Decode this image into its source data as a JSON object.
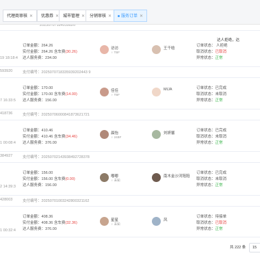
{
  "tabs": [
    {
      "label": "代理商审核",
      "active": false
    },
    {
      "label": "优惠券",
      "active": false
    },
    {
      "label": "城市管理",
      "active": false
    },
    {
      "label": "分销审核",
      "active": false
    },
    {
      "label": "服务订单",
      "active": true
    }
  ],
  "top_partial_order": "20250707184059826",
  "top_right_header": "达人拒绝，达",
  "orders": [
    {
      "time": "19 18:18:4",
      "total": "264.26",
      "paid": "264.26",
      "fare": "(30.26)",
      "service_fee": "234.00",
      "user_name": "访访",
      "user_tag": "TBF",
      "pro_name": "王千晗",
      "status_line1": "订单状态：",
      "status_line1_val": "人拒绝",
      "cancel_label": "取消状态：",
      "cancel_val": "已取消",
      "abnormal_label": "异常状态：",
      "abnormal_val": "正常"
    },
    {
      "time": "7 16:33:5",
      "total": "170.00",
      "paid": "170.00",
      "fare": "(14.00)",
      "service_fee": "156.00",
      "user_name": "佳佳",
      "user_tag": "TBF",
      "pro_name": "MIJA",
      "status_line1": "订单状态：",
      "status_line1_val": "已完成",
      "cancel_label": "取消状态：",
      "cancel_val": "未取消",
      "abnormal_label": "异常状态：",
      "abnormal_val": "正常"
    },
    {
      "time": "1 00:08:4",
      "total": "410.46",
      "paid": "410.46",
      "fare": "(34.46)",
      "service_fee": "376.00",
      "user_name": "晨怡",
      "user_tag": "24BF",
      "pro_name": "刘妍馨",
      "status_line1": "订单状态：",
      "status_line1_val": "已完成",
      "cancel_label": "取消状态：",
      "cancel_val": "未取消",
      "abnormal_label": "异常状态：",
      "abnormal_val": "正常"
    },
    {
      "time": "2 14:39:3",
      "total": "156.00",
      "paid": "156.00",
      "fare": "(0.00)",
      "service_fee": "156.00",
      "user_name": "嘟嘟",
      "user_tag": "未知",
      "pro_name": "南木金沙河陪陪",
      "status_line1": "订单状态：",
      "status_line1_val": "已完成",
      "cancel_label": "取消状态：",
      "cancel_val": "未取消",
      "abnormal_label": "异常状态：",
      "abnormal_val": "正常"
    },
    {
      "time": "1 00:32:4",
      "total": "408.36",
      "paid": "408.36",
      "fare": "(32.36)",
      "service_fee": "376.00",
      "user_name": "星星",
      "user_tag": "未知",
      "pro_name": "风",
      "status_line1": "订单状态：",
      "status_line1_val": "待接单",
      "cancel_label": "取消状态：",
      "cancel_val": "已取消",
      "abnormal_label": "异常状态：",
      "abnormal_val": "正常"
    }
  ],
  "order_numbers": [
    {
      "left": "593920",
      "label": "支付编号：",
      "value": "2025070718335939202443 9"
    },
    {
      "left": "418736",
      "label": "支付编号：",
      "value": "20250706000841873621721"
    },
    {
      "left": "384927",
      "label": "支付编号：",
      "value": "20250702143938492728378"
    },
    {
      "left": "428003",
      "label": "支付编号：",
      "value": "20250701003242800321162"
    }
  ],
  "labels": {
    "total": "订单金额：",
    "paid": "实付金额：",
    "fare": "含车费",
    "service_fee": "达人服务费："
  },
  "footer": {
    "total": "共 222 条",
    "page_size": "15"
  },
  "colors": {
    "accent": "#409eff",
    "green": "#39b54a",
    "red": "#e64340"
  }
}
